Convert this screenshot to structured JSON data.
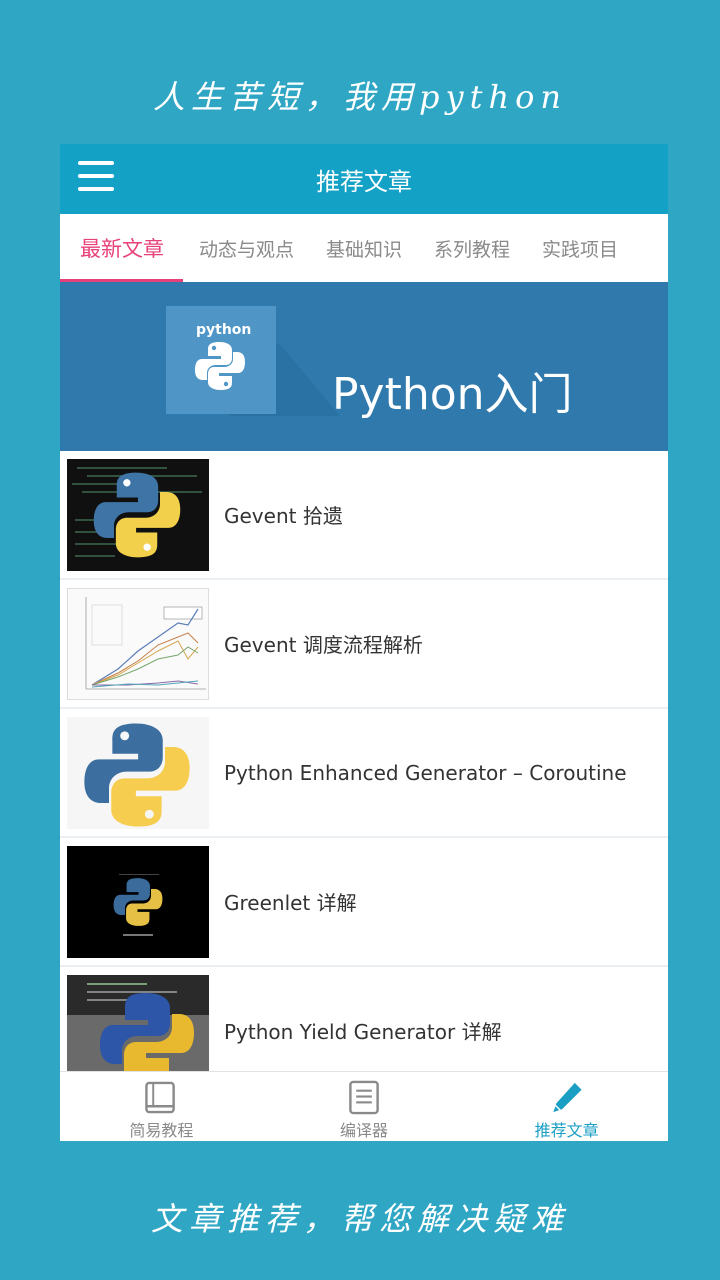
{
  "promo": {
    "top_text": "人生苦短，我用python",
    "bottom_text": "文章推荐，帮您解决疑难"
  },
  "appbar": {
    "title": "推荐文章",
    "menu_icon": "hamburger-menu-icon"
  },
  "tabs": [
    {
      "label": "最新文章",
      "active": true
    },
    {
      "label": "动态与观点",
      "active": false
    },
    {
      "label": "基础知识",
      "active": false
    },
    {
      "label": "系列教程",
      "active": false
    },
    {
      "label": "实践项目",
      "active": false
    }
  ],
  "banner": {
    "logo_text": "python",
    "title": "Python入门"
  },
  "articles": [
    {
      "title": "Gevent 拾遗",
      "thumb": "python-logo-code-background"
    },
    {
      "title": "Gevent 调度流程解析",
      "thumb": "line-chart"
    },
    {
      "title": "Python Enhanced Generator  –  Coroutine",
      "thumb": "python-logo"
    },
    {
      "title": "Greenlet 详解",
      "thumb": "python-logo-dark"
    },
    {
      "title": "Python Yield Generator 详解",
      "thumb": "python-toy-photo"
    }
  ],
  "bottom_nav": [
    {
      "label": "简易教程",
      "icon": "book-icon",
      "active": false
    },
    {
      "label": "编译器",
      "icon": "document-icon",
      "active": false
    },
    {
      "label": "推荐文章",
      "icon": "pencil-icon",
      "active": true
    }
  ],
  "colors": {
    "background": "#2ea6c4",
    "appbar": "#14a1c6",
    "tab_active": "#e8417a",
    "banner": "#2f79ac",
    "nav_active": "#1a9ec4"
  }
}
